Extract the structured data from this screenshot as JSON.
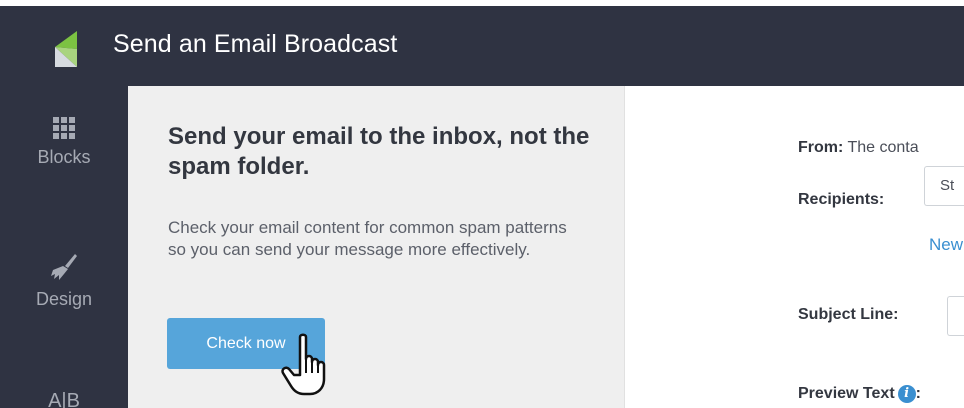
{
  "header": {
    "title": "Send an Email Broadcast"
  },
  "sidebar": {
    "items": [
      {
        "label": "Blocks",
        "icon": "grid-icon"
      },
      {
        "label": "Design",
        "icon": "paintbrush-icon"
      },
      {
        "label": "A|B",
        "icon": "ab-test-icon"
      }
    ]
  },
  "spam_panel": {
    "heading": "Send your email to the inbox, not the spam folder.",
    "body": "Check your email content for common spam patterns so you can send your message more effectively.",
    "button_label": "Check now"
  },
  "form": {
    "from_label": "From:",
    "from_value": "The conta",
    "recipients_label": "Recipients:",
    "recipients_value": "St",
    "new_link": "New",
    "subject_label": "Subject Line:",
    "subject_value": "I",
    "preview_label": "Preview Text",
    "preview_colon": ":"
  },
  "colors": {
    "topbar": "#2f3342",
    "panel_bg": "#efefef",
    "button": "#56a5da",
    "link": "#3a8fd0",
    "logo_green": "#7cc242"
  }
}
